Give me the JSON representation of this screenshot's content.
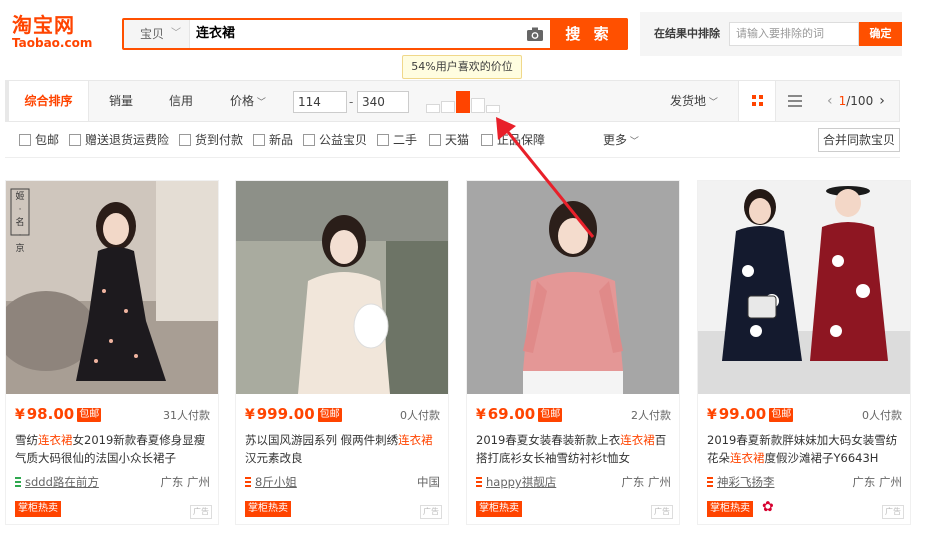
{
  "header": {
    "logo_cn": "淘宝网",
    "logo_en": "Taobao.com",
    "search_category": "宝贝",
    "search_query": "连衣裙",
    "search_button": "搜 索",
    "exclude_label": "在结果中排除",
    "exclude_placeholder": "请输入要排除的词",
    "exclude_button": "确定"
  },
  "tooltip": "54%用户喜欢的价位",
  "sortbar": {
    "items": [
      "综合排序",
      "销量",
      "信用",
      "价格"
    ],
    "price_min": "114",
    "price_max": "340",
    "price_dash": "-",
    "location": "发货地",
    "page_current": "1",
    "page_total": "/100",
    "histogram": [
      0.4,
      0.55,
      1.0,
      0.7,
      0.35
    ]
  },
  "filters": {
    "options": [
      "包邮",
      "赠送退货运费险",
      "货到付款",
      "新品",
      "公益宝贝",
      "二手",
      "天猫",
      "正品保障"
    ],
    "more": "更多",
    "merge": "合并同款宝贝"
  },
  "products": [
    {
      "yen": "¥",
      "price": "98.00",
      "bao": "包邮",
      "deals": "31人付款",
      "title_pre": "雪纺",
      "title_hl": "连衣裙",
      "title_post": "女2019新款春夏修身显瘦气质大码很仙的法国小众长裙子",
      "shop": "sddd路在前方",
      "location": "广东 广州",
      "hot": "掌柜热卖",
      "ad": "广告",
      "shop_color": "#2fa84f",
      "watermark": "姬 · 名 · 京"
    },
    {
      "yen": "¥",
      "price": "999.00",
      "bao": "包邮",
      "deals": "0人付款",
      "title_pre": "苏以国风游园系列 假两件刺绣",
      "title_hl": "连衣裙",
      "title_post": "汉元素改良",
      "shop": "8斤小姐",
      "location": "中国",
      "hot": "掌柜热卖",
      "ad": "广告",
      "shop_color": "#ff4400"
    },
    {
      "yen": "¥",
      "price": "69.00",
      "bao": "包邮",
      "deals": "2人付款",
      "title_pre": "2019春夏女装春装新款上衣",
      "title_hl": "连衣裙",
      "title_post": "百搭打底衫女长袖雪纺衬衫t恤女",
      "shop": "happy祺靓店",
      "location": "广东 广州",
      "hot": "掌柜热卖",
      "ad": "广告",
      "shop_color": "#ff4400"
    },
    {
      "yen": "¥",
      "price": "99.00",
      "bao": "包邮",
      "deals": "0人付款",
      "title_pre": "2019春夏新款胖妹妹加大码女装雪纺花朵",
      "title_hl": "连衣裙",
      "title_post": "度假沙滩裙子Y6643H",
      "shop": "神彩飞扬李",
      "location": "广东 广州",
      "hot": "掌柜热卖",
      "ad": "广告",
      "shop_color": "#ff4400"
    }
  ]
}
